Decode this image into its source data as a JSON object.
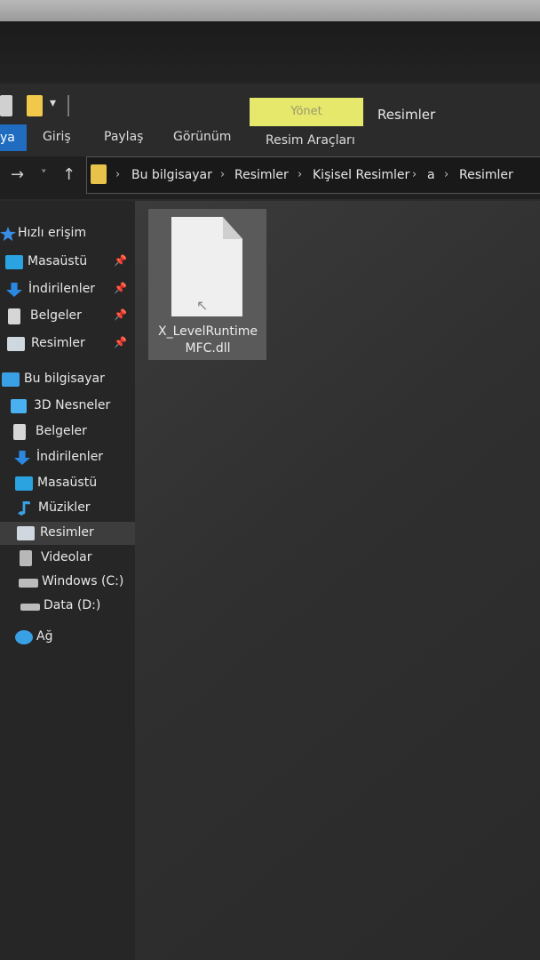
{
  "quick_access_toolbar": {
    "dropdown_glyph": "▾"
  },
  "ribbon": {
    "file_tab": "ya",
    "tabs": [
      "Giriş",
      "Paylaş",
      "Görünüm"
    ],
    "context_header": "Yönet",
    "context_tab": "Resim Araçları",
    "window_title": "Resimler"
  },
  "address_bar": {
    "back_glyph": "→",
    "recent_glyph": "˅",
    "up_glyph": "↑",
    "separator": "›",
    "breadcrumbs": [
      "Bu bilgisayar",
      "Resimler",
      "Kişisel Resimler",
      "a",
      "Resimler"
    ]
  },
  "sidebar": {
    "pin_glyph": "📌",
    "items": [
      {
        "label": "Hızlı erişim",
        "icon": "star-icon",
        "color": "#3a8ee6"
      },
      {
        "label": "Masaüstü",
        "icon": "desktop-icon",
        "color": "#2aa3e0",
        "pinned": true
      },
      {
        "label": "İndirilenler",
        "icon": "download-icon",
        "color": "#2a88e0",
        "pinned": true
      },
      {
        "label": "Belgeler",
        "icon": "documents-icon",
        "color": "#d6d6d6",
        "pinned": true
      },
      {
        "label": "Resimler",
        "icon": "pictures-icon",
        "color": "#cfd8e0",
        "pinned": true
      },
      {
        "label": "Bu bilgisayar",
        "icon": "computer-icon",
        "color": "#3aa0e6"
      },
      {
        "label": "3D Nesneler",
        "icon": "cube-icon",
        "color": "#4ab0f0"
      },
      {
        "label": "Belgeler",
        "icon": "documents-icon",
        "color": "#d6d6d6"
      },
      {
        "label": "İndirilenler",
        "icon": "download-icon",
        "color": "#2a88e0"
      },
      {
        "label": "Masaüstü",
        "icon": "desktop-icon",
        "color": "#2aa3e0"
      },
      {
        "label": "Müzikler",
        "icon": "music-icon",
        "color": "#3aa0e6"
      },
      {
        "label": "Resimler",
        "icon": "pictures-icon",
        "color": "#cfd8e0",
        "selected": true
      },
      {
        "label": "Videolar",
        "icon": "video-icon",
        "color": "#b8b8b8"
      },
      {
        "label": "Windows (C:)",
        "icon": "drive-icon",
        "color": "#bcbcbc"
      },
      {
        "label": "Data (D:)",
        "icon": "drive-icon",
        "color": "#bcbcbc"
      },
      {
        "label": "Ağ",
        "icon": "network-icon",
        "color": "#3aa0e6"
      }
    ]
  },
  "content": {
    "files": [
      {
        "name_line1": "X_LevelRuntime",
        "name_line2": "MFC.dll",
        "icon": "dll-file-icon"
      }
    ]
  },
  "colors": {
    "accent": "#1f6cc0",
    "context_tab": "#e6e86b",
    "folder": "#e9c24a",
    "background": "#2b2b2b"
  }
}
